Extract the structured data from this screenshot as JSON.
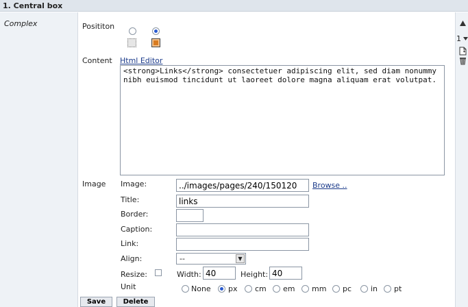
{
  "header": {
    "title": "1. Central box"
  },
  "left": {
    "type_label": "Complex"
  },
  "position": {
    "label": "Posititon",
    "selected": 1
  },
  "content": {
    "label": "Content",
    "editor_link": "Html Editor",
    "text": "<strong>Links</strong> consectetuer adipiscing elit, sed diam nonummy nibh euismod tincidunt ut laoreet dolore magna aliquam erat volutpat."
  },
  "image": {
    "section_label": "Image",
    "image_label": "Image:",
    "image_value": "../images/pages/240/150120",
    "browse_label": "Browse ..",
    "title_label": "Title:",
    "title_value": "links",
    "border_label": "Border:",
    "border_value": "",
    "caption_label": "Caption:",
    "caption_value": "",
    "link_label": "Link:",
    "link_value": "",
    "align_label": "Align:",
    "align_value": "--",
    "resize_label": "Resize:",
    "width_label": "Width:",
    "width_value": "40",
    "height_label": "Height:",
    "height_value": "40",
    "unit_label": "Unit",
    "units": [
      "None",
      "px",
      "cm",
      "em",
      "mm",
      "pc",
      "in",
      "pt"
    ],
    "unit_selected": "px"
  },
  "side": {
    "order_value": "1"
  },
  "buttons": {
    "save": "Save",
    "delete": "Delete"
  }
}
